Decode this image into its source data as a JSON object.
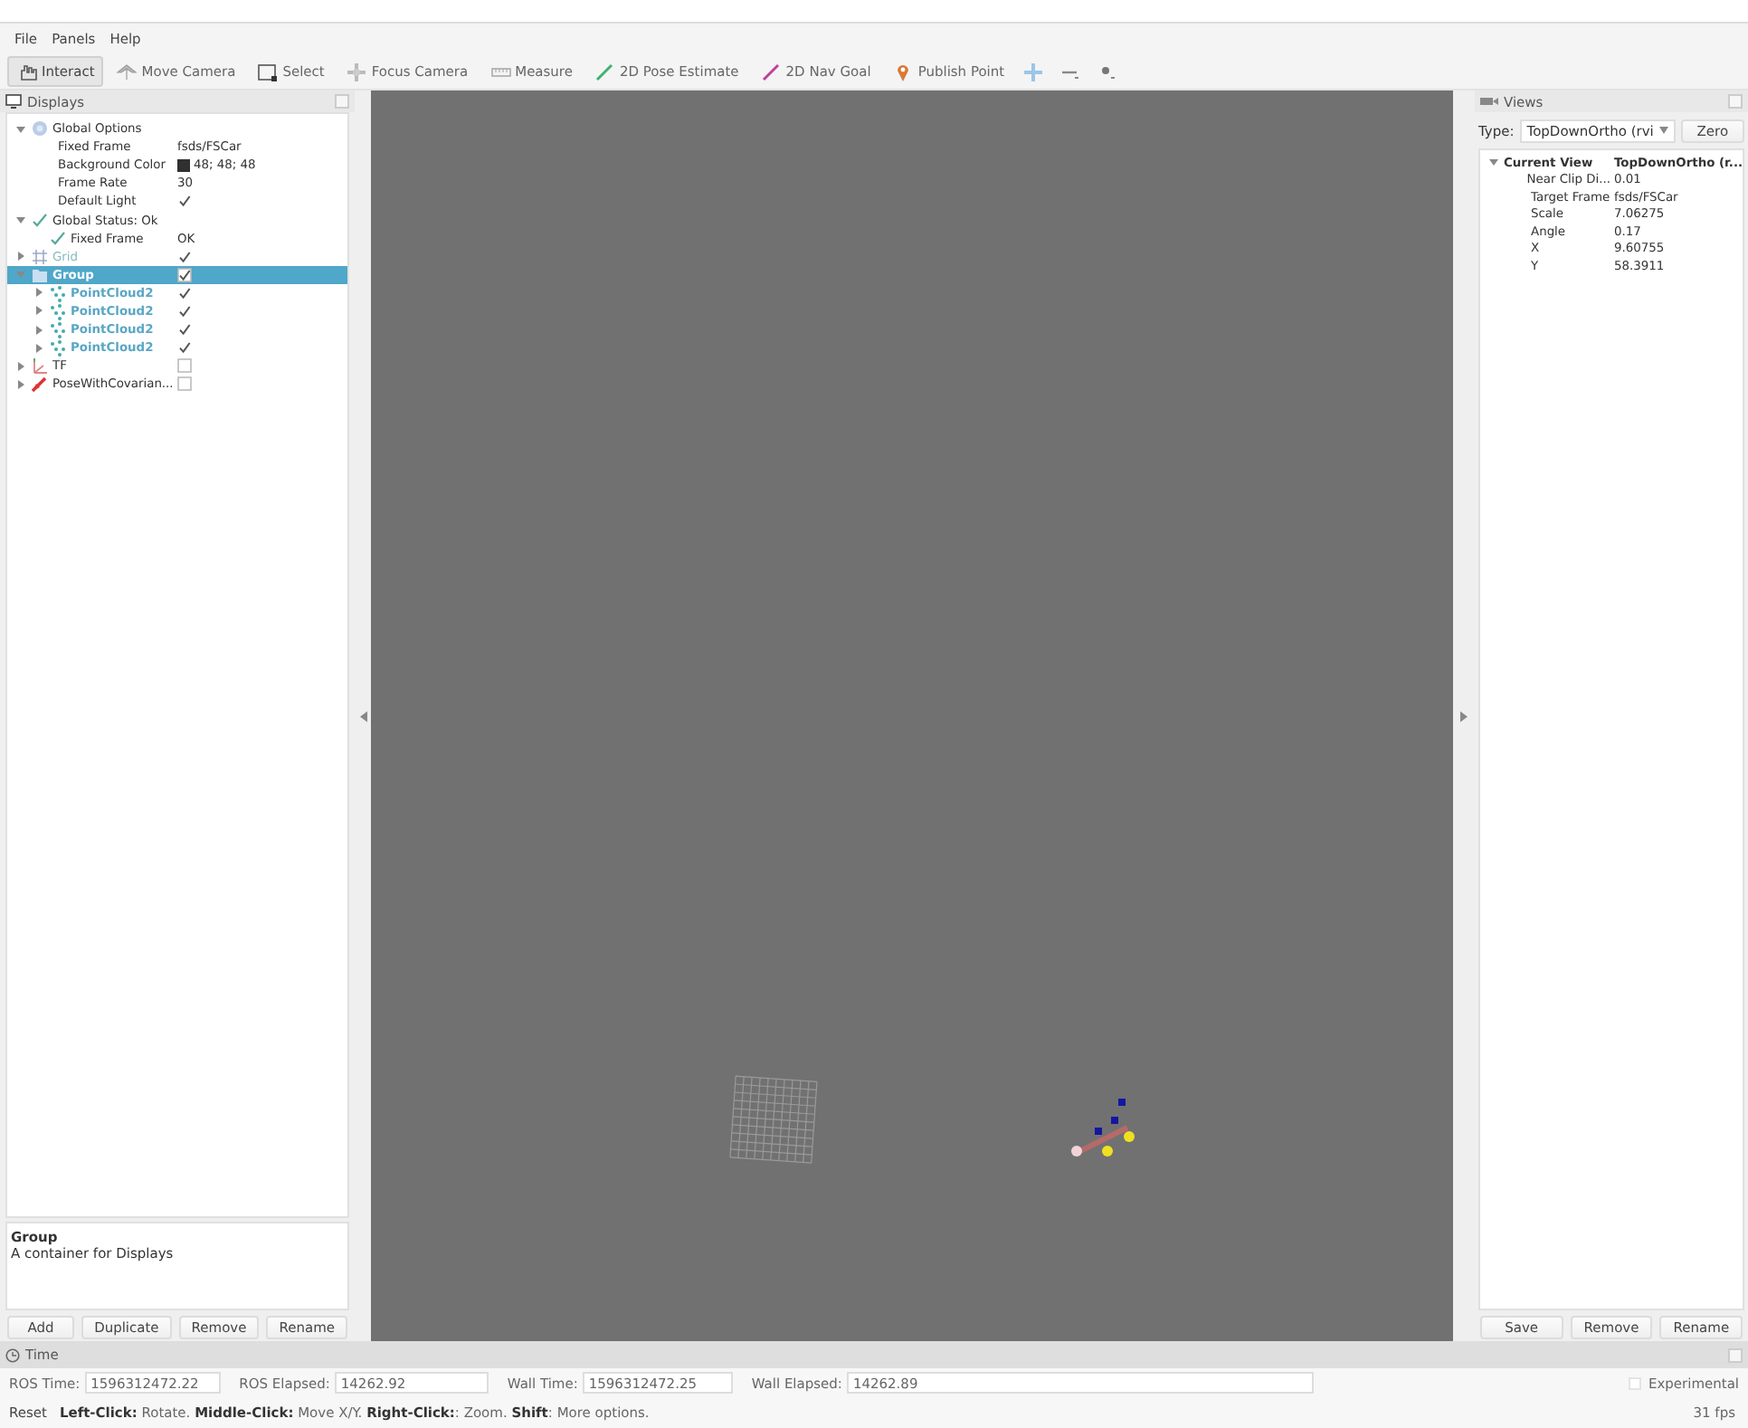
{
  "menu": [
    "File",
    "Panels",
    "Help"
  ],
  "toolbar": {
    "tools": [
      {
        "label": "Interact",
        "kind": "interact",
        "selected": true
      },
      {
        "label": "Move Camera",
        "kind": "move",
        "selected": false
      },
      {
        "label": "Select",
        "kind": "select",
        "selected": false
      },
      {
        "label": "Focus Camera",
        "kind": "focus",
        "selected": false
      },
      {
        "label": "Measure",
        "kind": "measure",
        "selected": false
      },
      {
        "label": "2D Pose Estimate",
        "kind": "pose",
        "selected": false
      },
      {
        "label": "2D Nav Goal",
        "kind": "goal",
        "selected": false
      },
      {
        "label": "Publish Point",
        "kind": "point",
        "selected": false
      }
    ],
    "extras": [
      {
        "kind": "add"
      },
      {
        "kind": "remove"
      },
      {
        "kind": "properties"
      }
    ]
  },
  "displays": {
    "title": "Displays",
    "tree": [
      {
        "label": "Global Options",
        "kind": "options",
        "expanded": true,
        "selected": false,
        "children": [
          {
            "label": "Fixed Frame",
            "kind": "property",
            "value": "fsds/FSCar",
            "selected": false
          },
          {
            "label": "Background Color",
            "kind": "property",
            "value": "48; 48; 48",
            "selected": false
          },
          {
            "label": "Frame Rate",
            "kind": "property",
            "value": "30",
            "selected": false
          },
          {
            "label": "Default Light",
            "kind": "property",
            "checked": true,
            "selected": false
          }
        ]
      },
      {
        "label": "Global Status: Ok",
        "kind": "status",
        "expanded": true,
        "selected": false,
        "children": [
          {
            "label": "Fixed Frame",
            "kind": "status",
            "value": "OK",
            "selected": false
          }
        ]
      },
      {
        "label": "Grid",
        "kind": "grid",
        "expanded": false,
        "checked": true,
        "selected": false
      },
      {
        "label": "Group",
        "kind": "group",
        "expanded": true,
        "checked": true,
        "selected": true,
        "children": [
          {
            "label": "PointCloud2",
            "kind": "pointcloud",
            "expanded": false,
            "checked": true,
            "selected": false
          },
          {
            "label": "PointCloud2",
            "kind": "pointcloud",
            "expanded": false,
            "checked": true,
            "selected": false
          },
          {
            "label": "PointCloud2",
            "kind": "pointcloud",
            "expanded": false,
            "checked": true,
            "selected": false
          },
          {
            "label": "PointCloud2",
            "kind": "pointcloud",
            "expanded": false,
            "checked": true,
            "selected": false
          }
        ]
      },
      {
        "label": "TF",
        "kind": "tf",
        "expanded": false,
        "checked": false,
        "selected": false
      },
      {
        "label": "PoseWithCovarian...",
        "kind": "posecov",
        "expanded": false,
        "checked": false,
        "selected": false
      }
    ],
    "description": {
      "title": "Group",
      "text": "A container for Displays"
    },
    "buttons": [
      "Add",
      "Duplicate",
      "Remove",
      "Rename"
    ]
  },
  "views": {
    "title": "Views",
    "type_label": "Type:",
    "type_value": "TopDownOrtho (rvi",
    "zero_button": "Zero",
    "tree": [
      {
        "label": "Current View",
        "value": "TopDownOrtho (r...",
        "expanded": true,
        "children": [
          {
            "label": "Near Clip Di...",
            "value": "0.01"
          },
          {
            "label": "Target Frame",
            "value": "fsds/FSCar"
          },
          {
            "label": "Scale",
            "value": "7.06275"
          },
          {
            "label": "Angle",
            "value": "0.17"
          },
          {
            "label": "X",
            "value": "9.60755"
          },
          {
            "label": "Y",
            "value": "58.3911"
          }
        ]
      }
    ],
    "buttons": [
      "Save",
      "Remove",
      "Rename"
    ]
  },
  "time": {
    "title": "Time",
    "fields": [
      {
        "label": "ROS Time:",
        "value": "1596312472.22"
      },
      {
        "label": "ROS Elapsed:",
        "value": "14262.92"
      },
      {
        "label": "Wall Time:",
        "value": "1596312472.25"
      },
      {
        "label": "Wall Elapsed:",
        "value": "14262.89"
      }
    ],
    "experimental": {
      "label": "Experimental",
      "checked": false
    }
  },
  "status_bar": {
    "reset_button": "Reset",
    "help": "**Left-Click:** Rotate. **Middle-Click:** Move X/Y. **Right-Click:**: Zoom. **Shift**: More options.",
    "fps": "31 fps"
  }
}
